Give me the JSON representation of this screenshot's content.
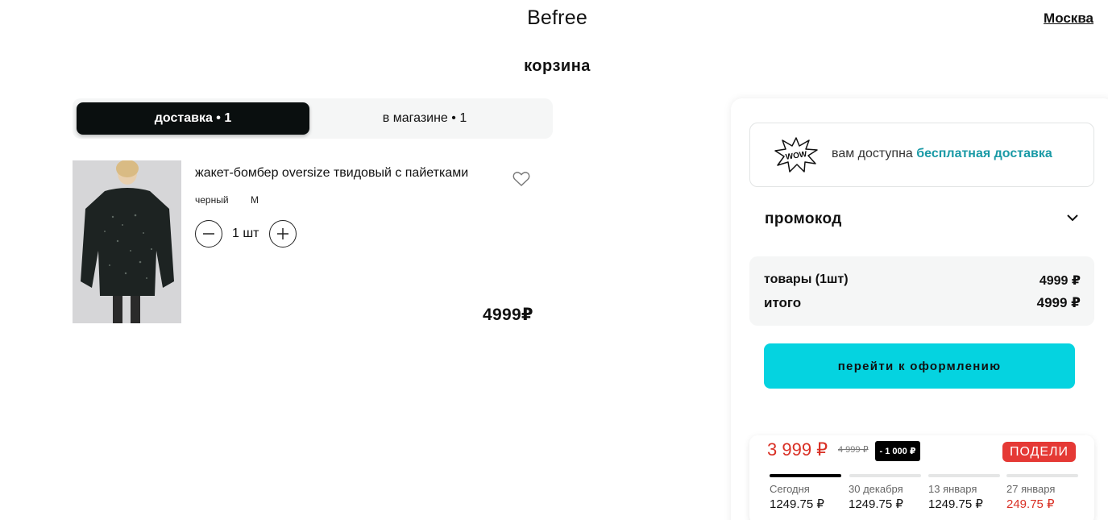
{
  "header": {
    "logo": "Befree",
    "city": "Москва"
  },
  "page_title": "корзина",
  "tabs": [
    {
      "label": "доставка • 1",
      "active": true
    },
    {
      "label": "в магазине • 1",
      "active": false
    }
  ],
  "cart_item": {
    "name": "жакет-бомбер oversize твидовый с пайетками",
    "color": "черный",
    "size": "M",
    "quantity": "1 шт",
    "price": "4999₽"
  },
  "free_delivery": {
    "icon_text": "WOW",
    "text": "вам доступна",
    "highlight": "бесплатная доставка",
    "highlight_color": "#1a9aa6"
  },
  "promo": {
    "label": "промокод"
  },
  "summary": {
    "goods_label": "товары (1шт)",
    "goods_value": "4999 ₽",
    "total_label": "итого",
    "total_value": "4999 ₽"
  },
  "checkout": {
    "label": "перейти к оформлению",
    "color": "#05d3e0"
  },
  "split_payment": {
    "price": "3 999 ₽",
    "old_price": "4 999 ₽",
    "discount": "- 1 000 ₽",
    "provider": "ПОДЕЛИ",
    "provider_color": "#e53935",
    "installments": [
      {
        "date": "Сегодня",
        "amount": "1249.75 ₽",
        "active": true
      },
      {
        "date": "30 декабря",
        "amount": "1249.75 ₽",
        "active": false
      },
      {
        "date": "13 января",
        "amount": "1249.75 ₽",
        "active": false
      },
      {
        "date": "27 января",
        "amount": "249.75 ₽",
        "active": false
      }
    ]
  }
}
